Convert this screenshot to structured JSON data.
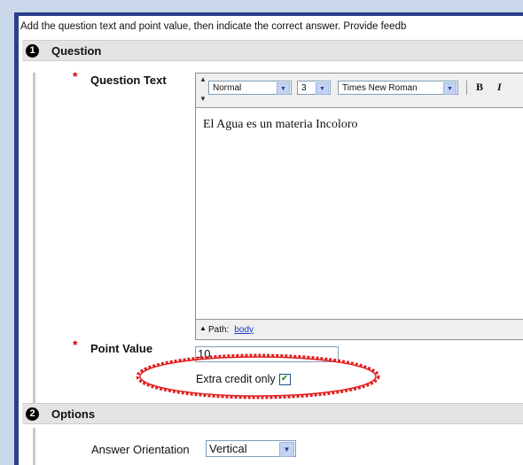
{
  "instructions": "Add the question text and point value, then indicate the correct answer. Provide feedb",
  "sections": [
    {
      "number": "1",
      "title": "Question"
    },
    {
      "number": "2",
      "title": "Options"
    }
  ],
  "question": {
    "required_marker": "*",
    "question_text_label": "Question Text",
    "editor": {
      "style_select": "Normal",
      "size_select": "3",
      "font_select": "Times New Roman",
      "bold_label": "B",
      "italic_label": "I",
      "content": "El Agua es un materia Incoloro",
      "path_label": "Path:",
      "path_link": "body"
    },
    "point_value_label": "Point Value",
    "point_value": "10",
    "extra_credit_label": "Extra credit only",
    "extra_credit_checked": true
  },
  "options": {
    "answer_orientation_label": "Answer Orientation",
    "answer_orientation_value": "Vertical"
  },
  "colors": {
    "frame": "#2a3f8c",
    "highlight_circle": "#e02020",
    "required": "#d00000",
    "link": "#1a3ac9"
  }
}
